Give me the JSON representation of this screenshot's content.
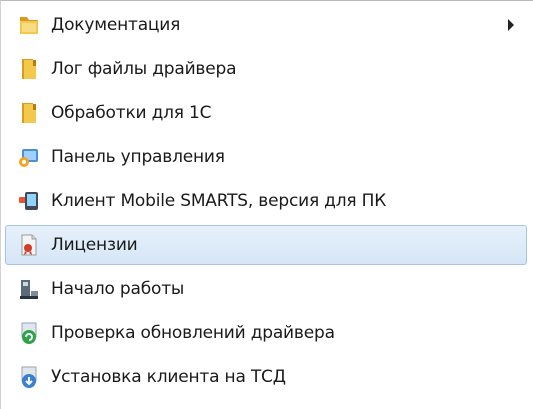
{
  "menu": {
    "items": [
      {
        "label": "Документация",
        "icon": "folder-icon",
        "submenu": true
      },
      {
        "label": "Лог файлы драйвера",
        "icon": "folder-icon"
      },
      {
        "label": "Обработки для 1С",
        "icon": "folder-icon"
      },
      {
        "label": "Панель управления",
        "icon": "control-panel-icon"
      },
      {
        "label": "Клиент Mobile SMARTS, версия для ПК",
        "icon": "mobile-client-icon"
      },
      {
        "label": "Лицензии",
        "icon": "license-icon",
        "selected": true
      },
      {
        "label": "Начало работы",
        "icon": "getting-started-icon"
      },
      {
        "label": "Проверка обновлений драйвера",
        "icon": "update-check-icon"
      },
      {
        "label": "Установка клиента на ТСД",
        "icon": "install-client-icon"
      }
    ],
    "colors": {
      "selection_bg": "#dce9f8",
      "selection_border": "#a7c4e8",
      "folder": "#e8b23a"
    }
  }
}
